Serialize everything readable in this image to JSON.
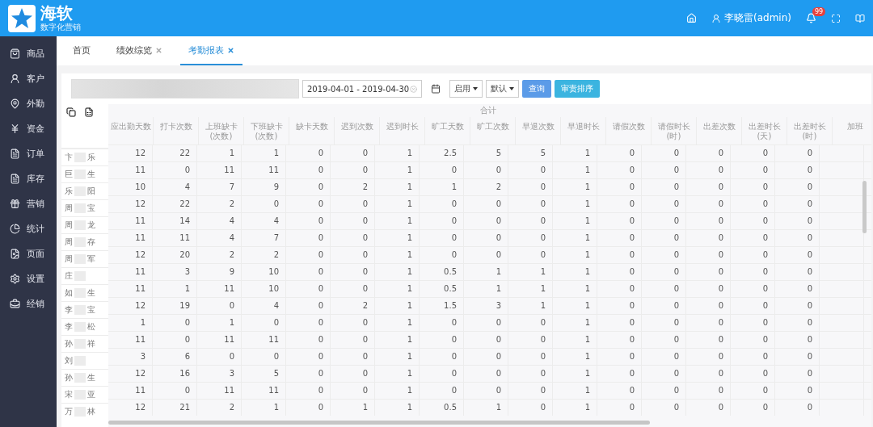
{
  "brand": {
    "name": "海软",
    "tagline": "数字化营销"
  },
  "header": {
    "user": "李晓雷(admin)",
    "notification_count": "99"
  },
  "sidebar": {
    "items": [
      {
        "label": "商品",
        "kind": "bag"
      },
      {
        "label": "客户",
        "kind": "user"
      },
      {
        "label": "外勤",
        "kind": "pin"
      },
      {
        "label": "资金",
        "kind": "yen"
      },
      {
        "label": "订单",
        "kind": "doc"
      },
      {
        "label": "库存",
        "kind": "doc"
      },
      {
        "label": "营销",
        "kind": "gift"
      },
      {
        "label": "统计",
        "kind": "pie"
      },
      {
        "label": "页面",
        "kind": "image"
      },
      {
        "label": "设置",
        "kind": "gear"
      },
      {
        "label": "经销",
        "kind": "case"
      }
    ]
  },
  "tabs": [
    {
      "label": "首页",
      "closable": false,
      "selected": false
    },
    {
      "label": "绩效综览",
      "closable": true,
      "selected": false
    },
    {
      "label": "考勤报表",
      "closable": true,
      "selected": true
    }
  ],
  "filters": {
    "date_range": "2019-04-01 - 2019-04-30",
    "status": "启用",
    "order": "默认",
    "buttons": [
      {
        "label": "查询",
        "kind": "primary"
      },
      {
        "label": "审责排序",
        "kind": "info"
      }
    ]
  },
  "table": {
    "group_header": "合计",
    "columns": [
      "应出勤天数",
      "打卡次数",
      "上班缺卡\n(次数)",
      "下班缺卡\n(次数)",
      "缺卡天数",
      "迟到次数",
      "迟到时长",
      "旷工天数",
      "旷工次数",
      "早退次数",
      "早退时长",
      "请假次数",
      "请假时长\n(时)",
      "出差次数",
      "出差时长\n(天)",
      "出差时长\n(时)",
      "加班"
    ],
    "rows": [
      {
        "name_first": "卞",
        "name_last": "乐",
        "cells": [
          "12",
          "22",
          "1",
          "1",
          "0",
          "0",
          "1",
          "2.5",
          "5",
          "5",
          "1",
          "0",
          "0",
          "0",
          "0",
          "0"
        ]
      },
      {
        "name_first": "巨",
        "name_last": "生",
        "cells": [
          "11",
          "0",
          "11",
          "11",
          "0",
          "0",
          "1",
          "0",
          "0",
          "0",
          "1",
          "0",
          "0",
          "0",
          "0",
          "0"
        ]
      },
      {
        "name_first": "乐",
        "name_last": "阳",
        "cells": [
          "10",
          "4",
          "7",
          "9",
          "0",
          "2",
          "1",
          "1",
          "2",
          "0",
          "1",
          "0",
          "0",
          "0",
          "0",
          "0"
        ]
      },
      {
        "name_first": "周",
        "name_last": "宝",
        "cells": [
          "12",
          "22",
          "2",
          "0",
          "0",
          "0",
          "1",
          "0",
          "0",
          "0",
          "1",
          "0",
          "0",
          "0",
          "0",
          "0"
        ]
      },
      {
        "name_first": "周",
        "name_last": "龙",
        "cells": [
          "11",
          "14",
          "4",
          "4",
          "0",
          "0",
          "1",
          "0",
          "0",
          "0",
          "1",
          "0",
          "0",
          "0",
          "0",
          "0"
        ]
      },
      {
        "name_first": "周",
        "name_last": "存",
        "cells": [
          "11",
          "11",
          "4",
          "7",
          "0",
          "0",
          "1",
          "0",
          "0",
          "0",
          "1",
          "0",
          "0",
          "0",
          "0",
          "0"
        ]
      },
      {
        "name_first": "周",
        "name_last": "军",
        "cells": [
          "12",
          "20",
          "2",
          "2",
          "0",
          "0",
          "1",
          "0",
          "0",
          "0",
          "1",
          "0",
          "0",
          "0",
          "0",
          "0"
        ]
      },
      {
        "name_first": "庄",
        "name_last": "",
        "cells": [
          "11",
          "3",
          "9",
          "10",
          "0",
          "0",
          "1",
          "0.5",
          "1",
          "1",
          "1",
          "0",
          "0",
          "0",
          "0",
          "0"
        ]
      },
      {
        "name_first": "如",
        "name_last": "生",
        "cells": [
          "11",
          "1",
          "11",
          "10",
          "0",
          "0",
          "1",
          "0.5",
          "1",
          "1",
          "1",
          "0",
          "0",
          "0",
          "0",
          "0"
        ]
      },
      {
        "name_first": "李",
        "name_last": "宝",
        "cells": [
          "12",
          "19",
          "0",
          "4",
          "0",
          "2",
          "1",
          "1.5",
          "3",
          "1",
          "1",
          "0",
          "0",
          "0",
          "0",
          "0"
        ]
      },
      {
        "name_first": "李",
        "name_last": "松",
        "cells": [
          "1",
          "0",
          "1",
          "0",
          "0",
          "0",
          "1",
          "0",
          "0",
          "0",
          "1",
          "0",
          "0",
          "0",
          "0",
          "0"
        ]
      },
      {
        "name_first": "孙",
        "name_last": "祥",
        "cells": [
          "11",
          "0",
          "11",
          "11",
          "0",
          "0",
          "1",
          "0",
          "0",
          "0",
          "1",
          "0",
          "0",
          "0",
          "0",
          "0"
        ]
      },
      {
        "name_first": "刘",
        "name_last": "",
        "cells": [
          "3",
          "6",
          "0",
          "0",
          "0",
          "0",
          "1",
          "0",
          "0",
          "0",
          "1",
          "0",
          "0",
          "0",
          "0",
          "0"
        ]
      },
      {
        "name_first": "孙",
        "name_last": "生",
        "cells": [
          "12",
          "16",
          "3",
          "5",
          "0",
          "0",
          "1",
          "0",
          "0",
          "0",
          "1",
          "0",
          "0",
          "0",
          "0",
          "0"
        ]
      },
      {
        "name_first": "宋",
        "name_last": "亚",
        "cells": [
          "11",
          "0",
          "11",
          "11",
          "0",
          "0",
          "1",
          "0",
          "0",
          "0",
          "1",
          "0",
          "0",
          "0",
          "0",
          "0"
        ]
      },
      {
        "name_first": "万",
        "name_last": "林",
        "cells": [
          "12",
          "21",
          "2",
          "1",
          "0",
          "1",
          "1",
          "0.5",
          "1",
          "0",
          "1",
          "0",
          "0",
          "0",
          "0",
          "0"
        ]
      }
    ]
  }
}
